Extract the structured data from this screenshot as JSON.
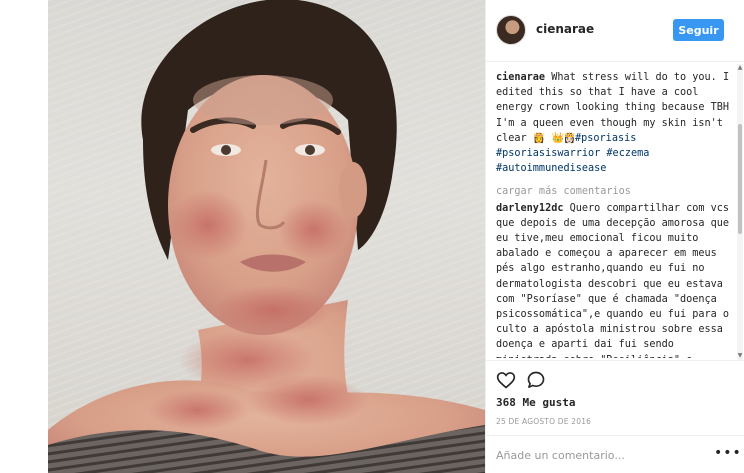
{
  "post": {
    "username": "cienarae",
    "follow_label": "Seguir",
    "caption": {
      "username": "cienarae",
      "text": " What stress will do to you. I edited this so that I have a cool energy crown looking thing because TBH I'm a queen even though my skin isn't clear ",
      "emoji_inline": "👸",
      "emoji_row": "👑👸🏻",
      "hashtags": [
        "#psoriasis",
        "#psoriasiswarrior",
        "#eczema",
        "#autoimmunedisease"
      ]
    },
    "load_more_label": "cargar más comentarios",
    "comments": [
      {
        "username": "darleny12dc",
        "text": " Quero compartilhar com vcs que depois de uma decepção amorosa que eu tive,meu emocional ficou muito abalado e começou a aparecer em meus pés algo estranho,quando eu fui no dermatologista descobri que eu estava com \"Psoríase\" que é chamada \"doença psicossomática\",e quando eu fui para o culto a apóstola ministrou sobre essa doença e aparti dai fui sendo ministrada sobre \"Resiliência\",e comecei a falar pra mim mesmo que um dia eu iria"
      }
    ],
    "likes_label": "368 Me gusta",
    "date_label": "25 DE AGOSTO DE 2016",
    "add_comment_placeholder": "Añade un comentario...",
    "more_label": "•••"
  },
  "icons": {
    "heart": "heart-icon",
    "comment": "comment-icon",
    "more": "more-options-icon"
  },
  "colors": {
    "follow_button": "#3897f0",
    "hashtag": "#003569",
    "muted_text": "#999999",
    "divider": "#efefef"
  }
}
